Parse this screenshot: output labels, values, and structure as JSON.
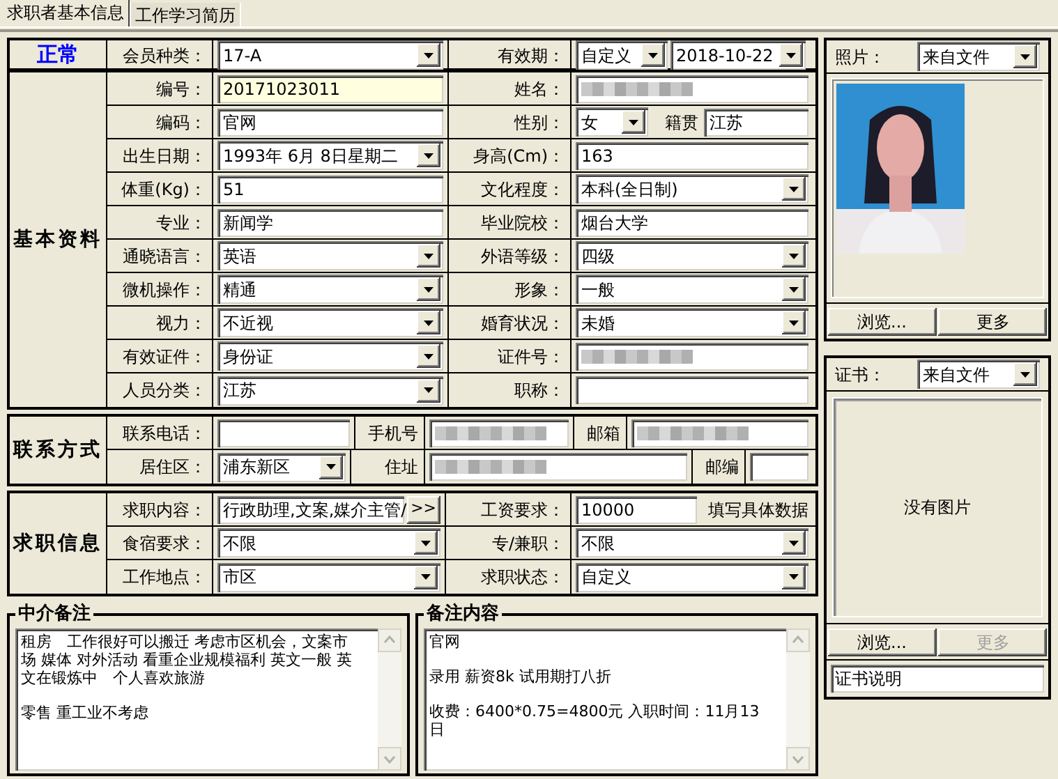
{
  "tabs": [
    {
      "label": "求职者基本信息",
      "selected": true
    },
    {
      "label": "工作学习简历",
      "selected": false
    }
  ],
  "membership": {
    "status": "正常",
    "fields": [
      {
        "label": "会员种类：",
        "kind": "select",
        "value": "17-A"
      },
      {
        "label": "有效期：",
        "kind": "select_pair",
        "value": "自定义",
        "value2": "2018-10-22"
      }
    ]
  },
  "basic": {
    "title": "基本资料",
    "fields": [
      {
        "label": "编号：",
        "kind": "text",
        "value": "20171023011",
        "highlighted": true
      },
      {
        "label": "姓名：",
        "kind": "text",
        "redacted": true
      },
      {
        "label": "编码：",
        "kind": "text",
        "value": "官网"
      },
      {
        "label": "性别：",
        "kind": "select_with_text",
        "value": "女",
        "label2": "籍贯",
        "value2": "江苏"
      },
      {
        "label": "出生日期：",
        "kind": "select",
        "value": "1993年 6月 8日星期二"
      },
      {
        "label": "身高(Cm)：",
        "kind": "text",
        "value": "163"
      },
      {
        "label": "体重(Kg)：",
        "kind": "text",
        "value": "51"
      },
      {
        "label": "文化程度：",
        "kind": "select",
        "value": "本科(全日制)"
      },
      {
        "label": "专业：",
        "kind": "text",
        "value": "新闻学"
      },
      {
        "label": "毕业院校：",
        "kind": "text",
        "value": "烟台大学"
      },
      {
        "label": "通晓语言：",
        "kind": "select",
        "value": "英语"
      },
      {
        "label": "外语等级：",
        "kind": "select",
        "value": "四级"
      },
      {
        "label": "微机操作：",
        "kind": "select",
        "value": "精通"
      },
      {
        "label": "形象：",
        "kind": "select",
        "value": "一般"
      },
      {
        "label": "视力：",
        "kind": "select",
        "value": "不近视"
      },
      {
        "label": "婚育状况：",
        "kind": "select",
        "value": "未婚"
      },
      {
        "label": "有效证件：",
        "kind": "select",
        "value": "身份证"
      },
      {
        "label": "证件号：",
        "kind": "text",
        "redacted": true
      },
      {
        "label": "人员分类：",
        "kind": "select",
        "value": "江苏"
      },
      {
        "label": "职称：",
        "kind": "text"
      }
    ]
  },
  "contact": {
    "title": "联系方式",
    "fields": [
      {
        "label": "联系电话：",
        "kind": "text"
      },
      {
        "label": "手机号",
        "kind": "text",
        "redacted": true
      },
      {
        "label": "邮箱",
        "kind": "text",
        "redacted": true
      },
      {
        "label": "居住区：",
        "kind": "select",
        "value": "浦东新区"
      },
      {
        "label": "住址",
        "kind": "text",
        "redacted": true
      },
      {
        "label": "邮编",
        "kind": "text"
      }
    ]
  },
  "job": {
    "title": "求职信息",
    "fields": [
      {
        "label": "求职内容：",
        "kind": "text_button",
        "value": "行政助理,文案,媒介主管/",
        "button": ">>"
      },
      {
        "label": "工资要求：",
        "kind": "text_note",
        "value": "10000",
        "note": "填写具体数据"
      },
      {
        "label": "食宿要求：",
        "kind": "select",
        "value": "不限"
      },
      {
        "label": "专/兼职：",
        "kind": "select",
        "value": "不限"
      },
      {
        "label": "工作地点：",
        "kind": "select",
        "value": "市区"
      },
      {
        "label": "求职状态：",
        "kind": "select",
        "value": "自定义"
      }
    ]
  },
  "notes": [
    {
      "title": "中介备注",
      "paragraphs": [
        "租房　工作很好可以搬迁 考虑市区机会，文案市场 媒体 对外活动 看重企业规模福利 英文一般 英文在锻炼中　个人喜欢旅游",
        "零售 重工业不考虑"
      ]
    },
    {
      "title": "备注内容",
      "paragraphs": [
        "官网",
        "录用 薪资8k 试用期打八折",
        "收费：6400*0.75=4800元 入职时间：11月13日"
      ]
    }
  ],
  "photo": {
    "label": "照片：",
    "source": "来自文件",
    "kind": "picture",
    "buttons": [
      {
        "label": "浏览...",
        "disabled": false
      },
      {
        "label": "更多",
        "disabled": false
      }
    ]
  },
  "certificate": {
    "label": "证书：",
    "source": "来自文件",
    "empty_text": "没有图片",
    "buttons": [
      {
        "label": "浏览...",
        "disabled": false
      },
      {
        "label": "更多",
        "disabled": true
      }
    ],
    "caption": "证书说明"
  }
}
